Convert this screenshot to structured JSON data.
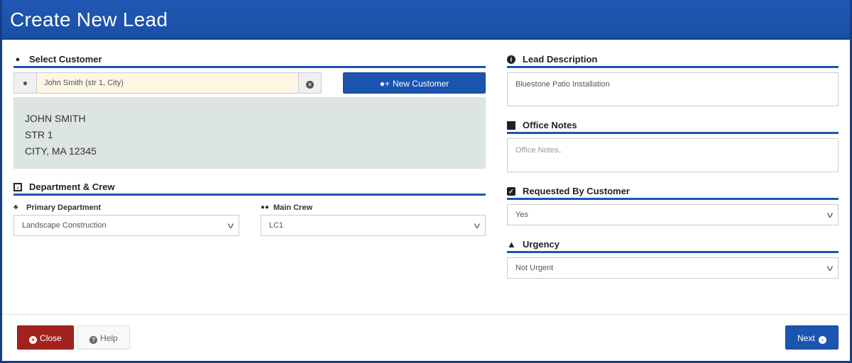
{
  "title": "Create New Lead",
  "select_customer": {
    "heading": "Select Customer",
    "value": "John Smith (str 1, City)",
    "new_customer_label": "New Customer",
    "address": [
      "JOHN SMITH",
      "STR 1",
      "CITY, MA 12345"
    ]
  },
  "department_crew": {
    "heading": "Department & Crew",
    "primary_department_label": "Primary Department",
    "primary_department_value": "Landscape Construction",
    "main_crew_label": "Main Crew",
    "main_crew_value": "LC1"
  },
  "lead_description": {
    "heading": "Lead Description",
    "value": "Bluestone Patio Installation"
  },
  "office_notes": {
    "heading": "Office Notes",
    "placeholder": "Office Notes.."
  },
  "requested_by_customer": {
    "heading": "Requested By Customer",
    "value": "Yes"
  },
  "urgency": {
    "heading": "Urgency",
    "value": "Not Urgent"
  },
  "footer": {
    "close_label": "Close",
    "help_label": "Help",
    "next_label": "Next"
  },
  "colors": {
    "header": "#1c55b0",
    "close": "#a3221e",
    "next": "#1c55b0",
    "address_bg": "#dce5e0",
    "customer_input_bg": "#fdf6e3"
  }
}
